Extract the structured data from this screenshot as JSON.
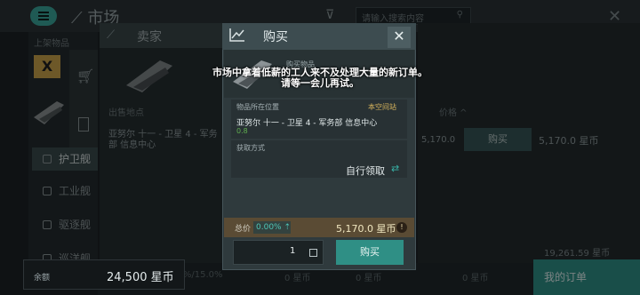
{
  "background": {
    "title": "市场",
    "search_placeholder": "请输入搜索内容",
    "left_header": "上架物品",
    "badge": "X",
    "categories": [
      "护卫舰",
      "工业舰",
      "驱逐舰",
      "巡洋舰"
    ],
    "seller_title": "卖家",
    "location_header": "出售地点",
    "location_text": "亚努尔 十一 - 卫星 4 - 军务部 信息中心",
    "price_header": "价格",
    "price_short": "5,170.0",
    "buy_label": "购买",
    "price_right": "5,170.0 星币",
    "price_right2": "19,261.59 星币",
    "bottom_text": "8.0%/15.0%",
    "bottom_price1": "0 星币",
    "bottom_price2": "0 星币",
    "bottom_price3": "0 星币",
    "my_orders": "我的订单"
  },
  "balance": {
    "label": "余额",
    "value": "24,500 星币"
  },
  "modal": {
    "title": "购买",
    "item_subtitle": "购买物品",
    "notice_line1": "市场中拿着低薪的工人来不及处理大量的新订单。",
    "notice_line2": "请等一会儿再试。",
    "location_label": "物品所在位置",
    "location_tag": "本空间站",
    "location_value": "亚努尔 十一 - 卫星 4 - 军务部 信息中心",
    "security": "0.8",
    "method_label": "获取方式",
    "method_value": "自行领取",
    "total_label": "总价",
    "tax_percent": "0.00%",
    "total_value": "5,170.0 星币",
    "quantity": "1",
    "buy_label": "购买"
  },
  "colors": {
    "accent": "#2f8f85",
    "gold": "#d7b45c",
    "security_green": "#5fae4f"
  }
}
